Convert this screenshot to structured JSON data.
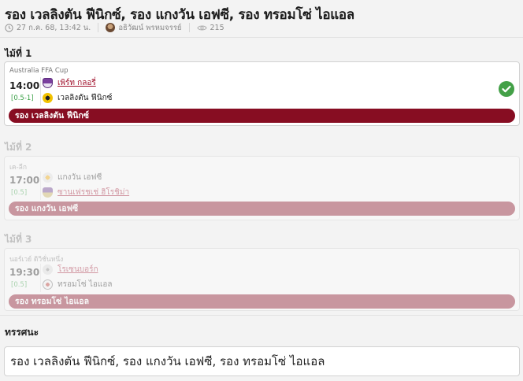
{
  "header": {
    "title": "รอง เวลลิงตัน ฟีนิกซ์, รอง แกงวัน เอฟซี, รอง ทรอมโซ่ ไอแอล",
    "date": "27 ก.ค. 68, 13:42 น.",
    "author": "อธิวัฒน์ พรหมจรรย์",
    "views": "215",
    "icons": [
      "clock-icon",
      "avatar",
      "eye-icon"
    ]
  },
  "pairs": [
    {
      "label": "ไม้ที่ 1",
      "league": "Australia FFA Cup",
      "time": "14:00",
      "handicap": "[0.5-1]",
      "home": {
        "name": "เพิร์ท กลอรี่",
        "favorite": true,
        "logo": "perth-glory-logo"
      },
      "away": {
        "name": "เวลลิงตัน ฟีนิกซ์",
        "favorite": false,
        "logo": "wellington-phoenix-logo"
      },
      "pick": "รอง เวลลิงตัน ฟีนิกซ์",
      "result": "win",
      "result_icon": "check-circle-icon",
      "state": "active"
    },
    {
      "label": "ไม้ที่ 2",
      "league": "เค-ลีก",
      "time": "17:00",
      "handicap": "[0.5]",
      "home": {
        "name": "แกงวัน เอฟซี",
        "favorite": false,
        "logo": "gangwon-fc-logo"
      },
      "away": {
        "name": "ซานเฟรชเช่ ฮิโรชิม่า",
        "favorite": true,
        "logo": "sanfrecce-hiroshima-logo"
      },
      "pick": "รอง แกงวัน เอฟซี",
      "state": "pending"
    },
    {
      "label": "ไม้ที่ 3",
      "league": "นอร์เวย์ ดิวิชั่นหนึ่ง",
      "time": "19:30",
      "handicap": "[0.5]",
      "home": {
        "name": "โรเซนบอร์ก",
        "favorite": true,
        "logo": "rosenborg-logo"
      },
      "away": {
        "name": "ทรอมโซ่ ไอแอล",
        "favorite": false,
        "logo": "tromso-il-logo"
      },
      "pick": "รอง ทรอมโซ่ ไอแอล",
      "state": "pending"
    }
  ],
  "summary": {
    "label": "ทรรศนะ",
    "text": "รอง เวลลิงตัน ฟีนิกซ์, รอง แกงวัน เอฟซี, รอง ทรอมโซ่ ไอแอล"
  },
  "colors": {
    "pick_bar": "#870d22",
    "favorite_team": "#a0102b",
    "handicap": "#3aa046",
    "win_check": "#43a047"
  }
}
